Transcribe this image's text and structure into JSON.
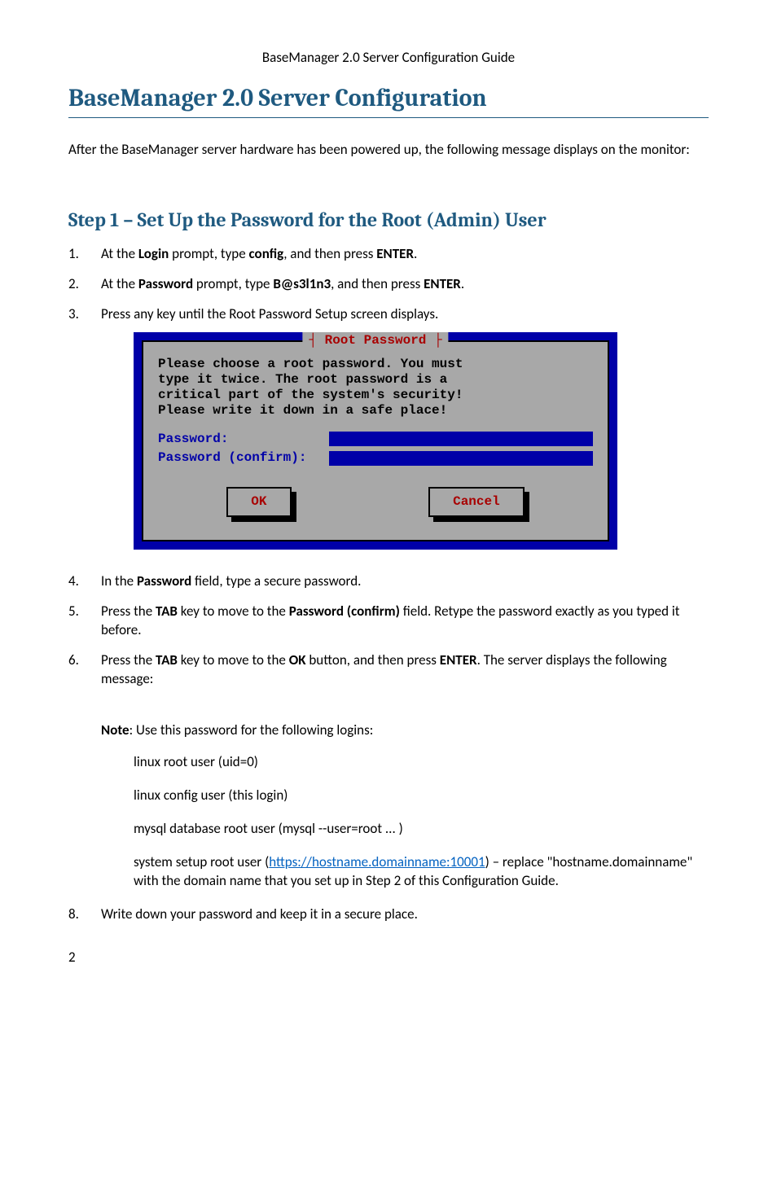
{
  "running_header": "BaseManager 2.0 Server Configuration Guide",
  "h1": "BaseManager 2.0 Server Configuration",
  "intro": "After the BaseManager server hardware has been powered up, the following message displays on the monitor:",
  "h2": "Step 1 – Set Up the Password for the Root (Admin) User",
  "steps": {
    "s1_a": "At the ",
    "s1_b": "Login",
    "s1_c": " prompt, type ",
    "s1_d": "config",
    "s1_e": ", and then press ",
    "s1_f": "ENTER",
    "s1_g": ".",
    "s2_a": "At the ",
    "s2_b": "Password",
    "s2_c": " prompt, type ",
    "s2_d": "B@s3l1n3",
    "s2_e": ", and then press ",
    "s2_f": "ENTER",
    "s2_g": ".",
    "s3": "Press any key until the Root Password Setup screen displays.",
    "s4_a": "In the ",
    "s4_b": "Password",
    "s4_c": " field, type a secure password.",
    "s5_a": "Press the ",
    "s5_b": "TAB",
    "s5_c": " key to move to the ",
    "s5_d": "Password (confirm)",
    "s5_e": " field. Retype the password exactly as you typed it before.",
    "s6_a": "Press the ",
    "s6_b": "TAB",
    "s6_c": " key to move to the ",
    "s6_d": "OK",
    "s6_e": " button, and then press ",
    "s6_f": "ENTER",
    "s6_g": ". The server displays the following message:",
    "s8": "Write down your password and keep it in a secure place."
  },
  "step8_counter": "8",
  "dialog": {
    "title": "Root Password",
    "body": "Please choose a root password. You must\ntype it twice. The root password is a\ncritical part of the system's security!\nPlease write it down in a safe place!",
    "pw_label": "Password:",
    "pw_confirm_label": "Password (confirm):",
    "ok": "OK",
    "cancel": "Cancel"
  },
  "note_label": "Note",
  "note_text": ": Use this password for the following logins:",
  "logins": {
    "l1": "linux root user (uid=0)",
    "l2": "linux config user (this login)",
    "l3": "mysql database root user (mysql --user=root ... )",
    "l4_a": "system setup root user (",
    "l4_link": "https://hostname.domainname:10001",
    "l4_b": ") – replace \"hostname.domainname\" with the domain name that you set up in Step 2 of this Configuration Guide."
  },
  "page_number": "2"
}
